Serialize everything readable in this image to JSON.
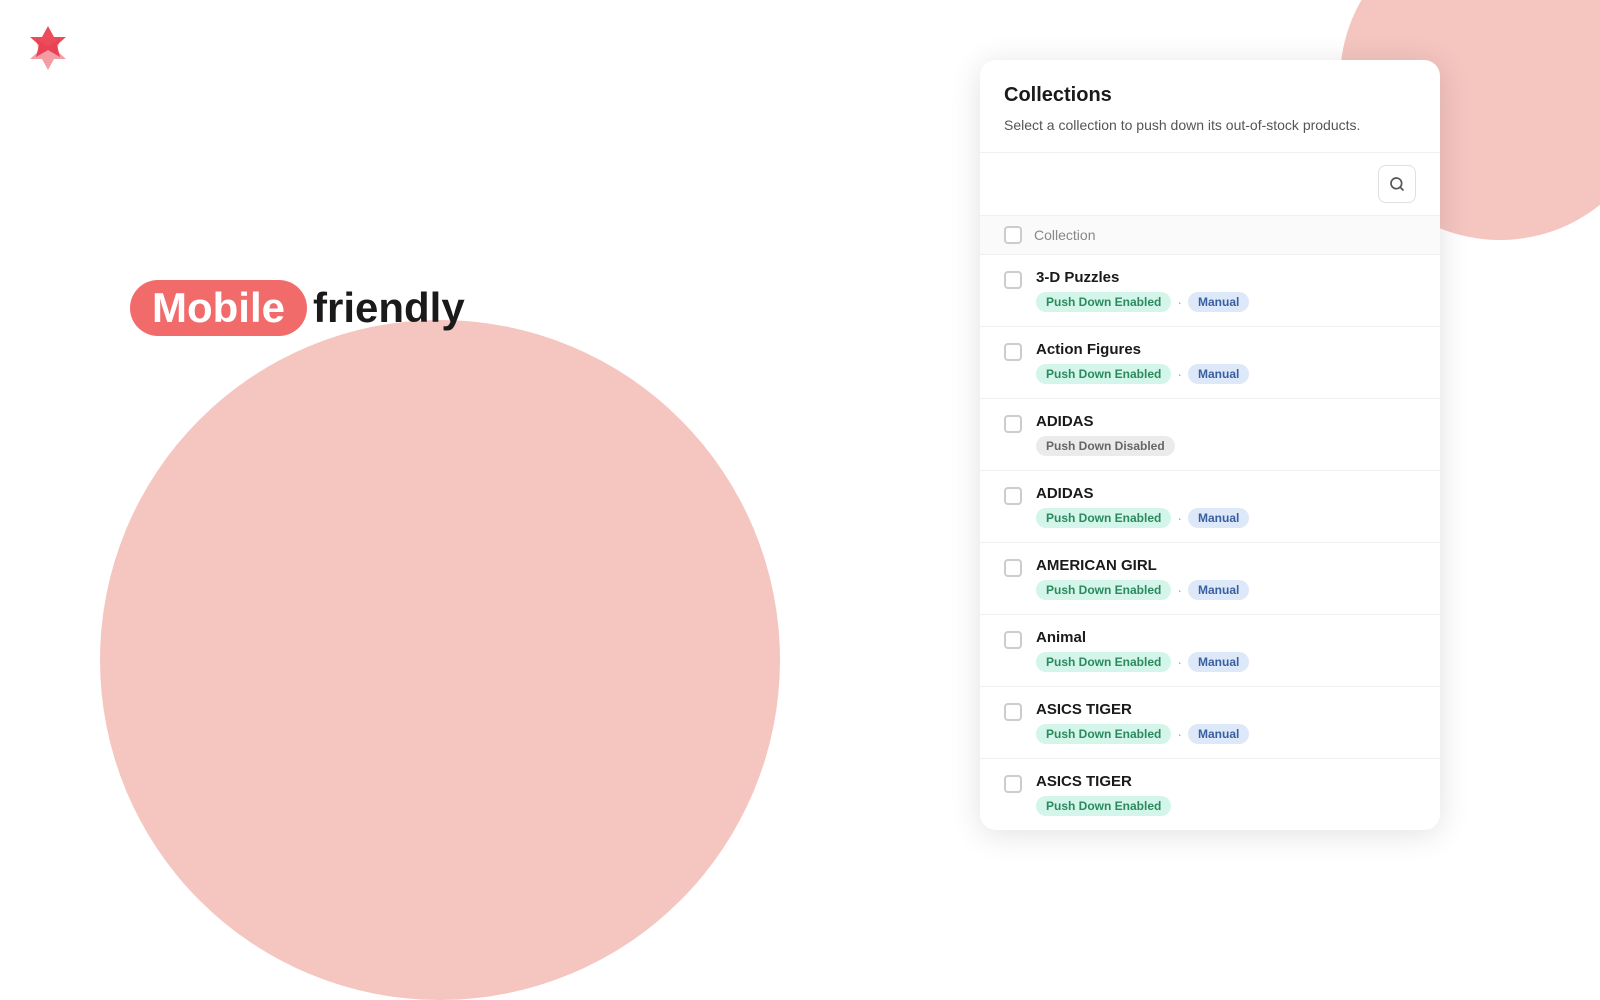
{
  "logo": {
    "alt": "App Logo"
  },
  "hero": {
    "mobile_label": "Mobile",
    "friendly_label": "friendly"
  },
  "panel": {
    "title": "Collections",
    "subtitle": "Select a collection to push down its out-of-stock products.",
    "search_placeholder": "",
    "search_button_label": "Search",
    "column_header": "Collection",
    "items": [
      {
        "name": "3-D Puzzles",
        "status": "Push Down Enabled",
        "status_type": "green",
        "mode": "Manual",
        "mode_type": "blue"
      },
      {
        "name": "Action Figures",
        "status": "Push Down Enabled",
        "status_type": "green",
        "mode": "Manual",
        "mode_type": "blue"
      },
      {
        "name": "ADIDAS",
        "status": "Push Down Disabled",
        "status_type": "gray",
        "mode": null,
        "mode_type": null
      },
      {
        "name": "ADIDAS",
        "status": "Push Down Enabled",
        "status_type": "green",
        "mode": "Manual",
        "mode_type": "blue"
      },
      {
        "name": "AMERICAN GIRL",
        "status": "Push Down Enabled",
        "status_type": "green",
        "mode": "Manual",
        "mode_type": "blue"
      },
      {
        "name": "Animal",
        "status": "Push Down Enabled",
        "status_type": "green",
        "mode": "Manual",
        "mode_type": "blue"
      },
      {
        "name": "ASICS TIGER",
        "status": "Push Down Enabled",
        "status_type": "green",
        "mode": "Manual",
        "mode_type": "blue"
      },
      {
        "name": "ASICS TIGER",
        "status": "Push Down Enabled",
        "status_type": "green",
        "mode": null,
        "mode_type": null
      }
    ],
    "badge_labels": {
      "push_down_enabled": "Push Down Enabled",
      "push_down_disabled": "Push Down Disabled",
      "manual": "Manual"
    }
  }
}
